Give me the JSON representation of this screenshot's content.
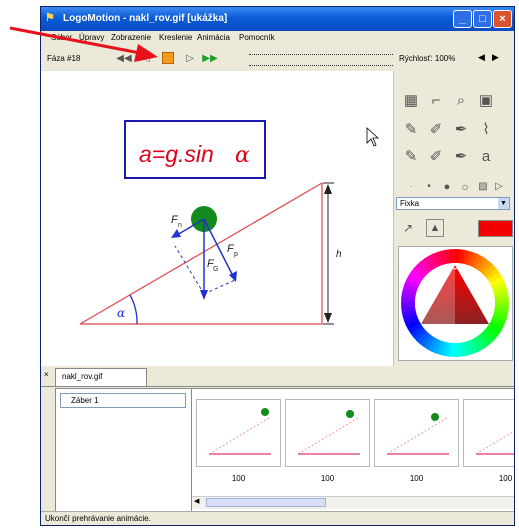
{
  "window": {
    "title": "LogoMotion - nakl_rov.gif [ukážka]"
  },
  "menu": {
    "items": [
      "Súbor",
      "Úpravy",
      "Zobrazenie",
      "Kreslenie",
      "Animácia",
      "Pomocník"
    ]
  },
  "toolbar": {
    "phase_label": "Fáza #18",
    "speed_label": "Rýchlosť: 100%"
  },
  "canvas": {
    "formula": "a=g.sin",
    "formula_symbol": "α",
    "label_fn_main": "F",
    "label_fn_sub": "n",
    "label_fg_main": "F",
    "label_fg_sub": "G",
    "label_fp_main": "F",
    "label_fp_sub": "p",
    "label_h": "h",
    "label_alpha": "α"
  },
  "palette": {
    "pen_type": "Fixka",
    "color": "#f00000"
  },
  "bottom": {
    "tab_label": "nakl_rov.gif",
    "list_item": "Záber 1",
    "thumb_labels": [
      "100",
      "100",
      "100",
      "100"
    ]
  },
  "status": {
    "text": "Ukončí prehrávanie animácie."
  },
  "colors": {
    "accent": "#e0001b",
    "formula_box": "#1a1ab0",
    "ball": "#138a1c",
    "vector": "#2233cc"
  }
}
